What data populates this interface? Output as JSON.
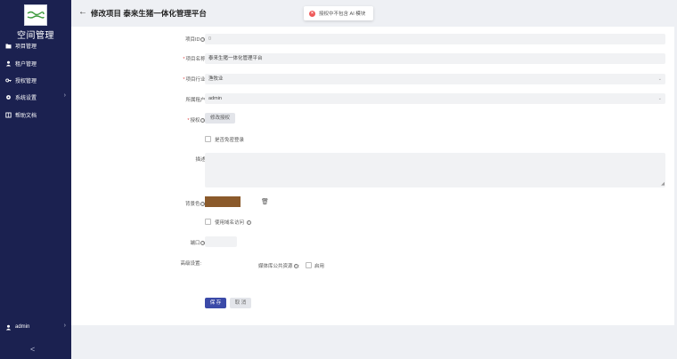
{
  "sidebar": {
    "app_title": "空间管理",
    "items": [
      {
        "label": "项目管理",
        "icon": "folder-icon"
      },
      {
        "label": "租户管理",
        "icon": "user-icon"
      },
      {
        "label": "授权管理",
        "icon": "key-icon"
      },
      {
        "label": "系统设置",
        "icon": "gear-icon"
      },
      {
        "label": "帮助文档",
        "icon": "book-icon"
      }
    ],
    "user": {
      "label": "admin"
    },
    "collapse": "<"
  },
  "header": {
    "back": "←",
    "title": "修改项目 泰来生猪一体化管理平台"
  },
  "toast": {
    "message": "授权中不包含 AI 模块"
  },
  "form": {
    "project_id": {
      "label": "项目ID",
      "value": "0"
    },
    "project_name": {
      "label": "项目名称:",
      "value": "泰来生猪一体化管理平台"
    },
    "industry": {
      "label": "项目行业:",
      "value": "渔牧业"
    },
    "tenant": {
      "label": "所属租户:",
      "value": "admin"
    },
    "license": {
      "label": "授权",
      "button": "修改授权"
    },
    "no_login": {
      "label": "是否免密登录"
    },
    "description": {
      "label": "描述:"
    },
    "background": {
      "label": "背景色",
      "color": "#8b5a2b"
    },
    "domain_access": {
      "label": "使用域名访问"
    },
    "port": {
      "label": "端口"
    },
    "advanced": {
      "label": "高级设置:",
      "media_public": "媒体库公共资源",
      "enable": "启用"
    },
    "save": "保 存",
    "cancel": "取 消"
  },
  "colors": {
    "sidebar": "#1b2150",
    "primary": "#3b4aa8",
    "error": "#ef5a5a"
  }
}
